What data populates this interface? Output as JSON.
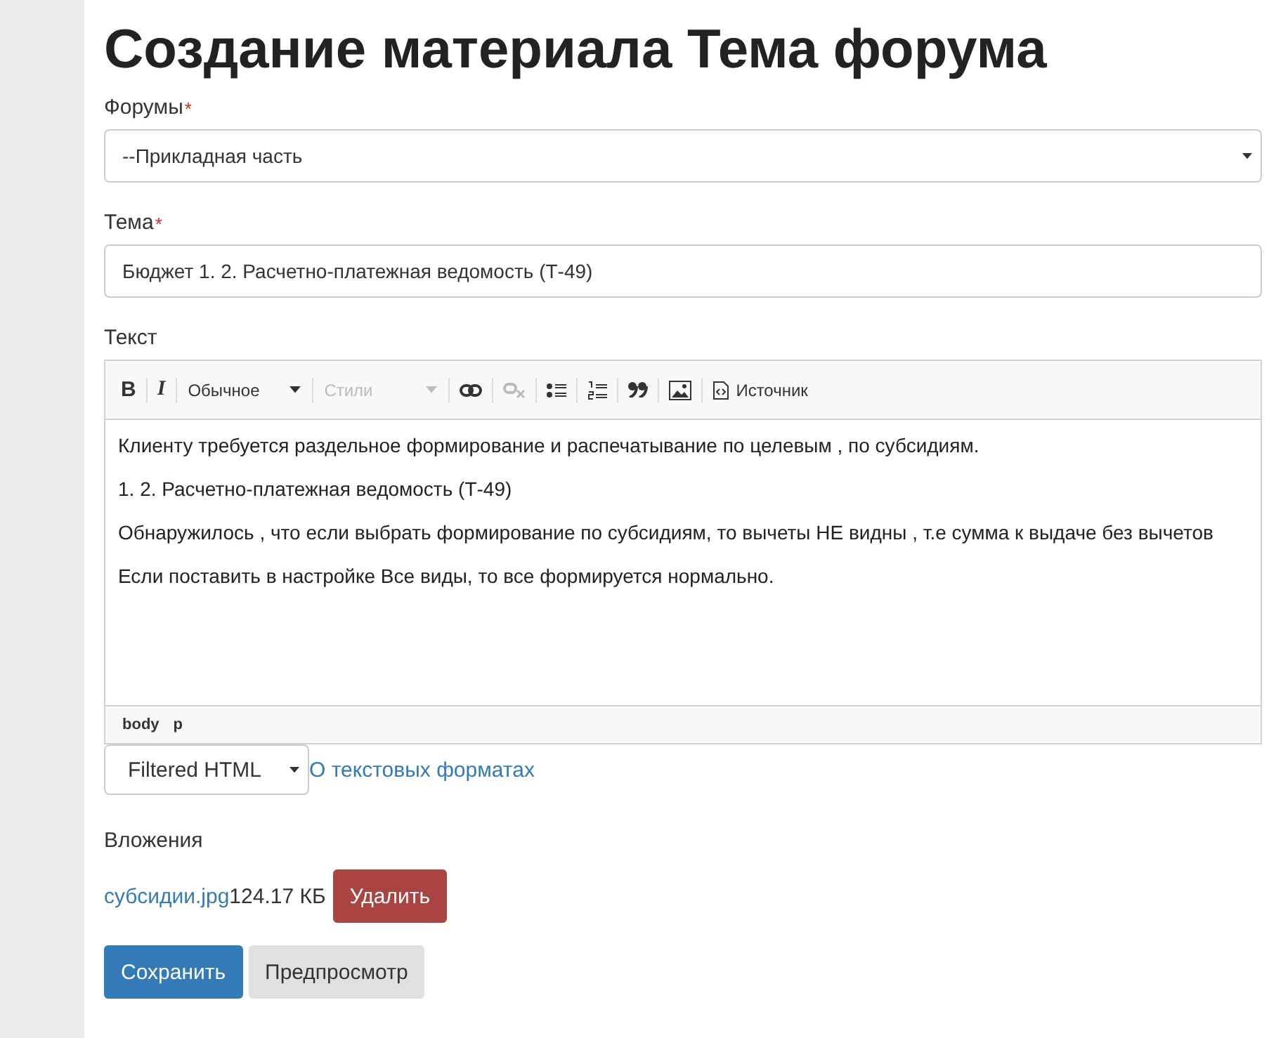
{
  "title": "Создание материала Тема форума",
  "forum": {
    "label": "Форумы",
    "required_mark": "*",
    "value": "--Прикладная часть"
  },
  "topic": {
    "label": "Тема",
    "required_mark": "*",
    "value": "Бюджет 1. 2. Расчетно-платежная ведомость (Т-49)"
  },
  "text": {
    "label": "Текст",
    "toolbar": [
      {
        "kind": "button",
        "label": "B",
        "disabled": false
      },
      {
        "kind": "button",
        "label": "I",
        "disabled": false
      },
      {
        "kind": "dropdown",
        "label": "Обычное",
        "disabled": false
      },
      {
        "kind": "dropdown",
        "label": "Стили",
        "disabled": true
      },
      {
        "kind": "button",
        "disabled": false
      },
      {
        "kind": "button",
        "disabled": true
      },
      {
        "kind": "button",
        "disabled": false
      },
      {
        "kind": "button",
        "disabled": false
      },
      {
        "kind": "button",
        "disabled": false
      },
      {
        "kind": "button",
        "disabled": false
      },
      {
        "kind": "button",
        "label": "Источник",
        "disabled": false
      }
    ],
    "paragraphs": [
      "Клиенту требуется раздельное формирование и распечатывание по целевым , по субсидиям.",
      "1. 2. Расчетно-платежная ведомость (Т-49)",
      "Обнаружилось , что если выбрать формирование  по субсидиям, то вычеты НЕ видны , т.е сумма к выдаче без вычетов",
      "Если поставить в настройке Все виды, то все формируется нормально."
    ],
    "path": [
      "body",
      "p"
    ]
  },
  "format": {
    "value": "Filtered HTML",
    "help_link": "О текстовых форматах"
  },
  "attachments": {
    "label": "Вложения",
    "files": [
      {
        "name": "субсидии.jpg",
        "size": "124.17 КБ",
        "delete": "Удалить"
      }
    ]
  },
  "buttons": [
    {
      "label": "Сохранить",
      "kind": "primary"
    },
    {
      "label": "Предпросмотр",
      "kind": "default"
    }
  ]
}
